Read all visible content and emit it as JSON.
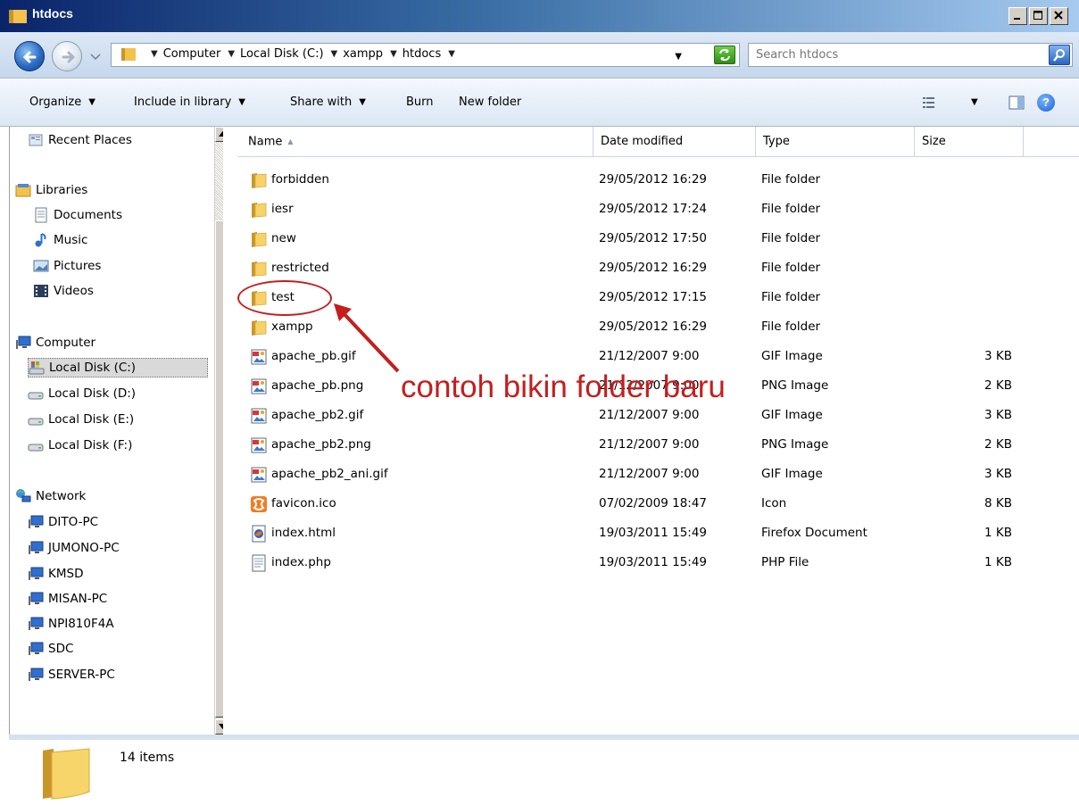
{
  "window": {
    "title": "htdocs"
  },
  "address": {
    "crumbs": [
      "Computer",
      "Local Disk (C:)",
      "xampp",
      "htdocs"
    ]
  },
  "search": {
    "placeholder": "Search htdocs"
  },
  "toolbar": {
    "organize": "Organize",
    "include_in_library": "Include in library",
    "share_with": "Share with",
    "burn": "Burn",
    "new_folder": "New folder"
  },
  "nav": {
    "recent_places": "Recent Places",
    "libraries": "Libraries",
    "documents": "Documents",
    "music": "Music",
    "pictures": "Pictures",
    "videos": "Videos",
    "computer": "Computer",
    "disk_c": "Local Disk (C:)",
    "disk_d": "Local Disk (D:)",
    "disk_e": "Local Disk (E:)",
    "disk_f": "Local Disk (F:)",
    "network": "Network",
    "pc1": "DITO-PC",
    "pc2": "JUMONO-PC",
    "pc3": "KMSD",
    "pc4": "MISAN-PC",
    "pc5": "NPI810F4A",
    "pc6": "SDC",
    "pc7": "SERVER-PC"
  },
  "columns": {
    "name": "Name",
    "date": "Date modified",
    "type": "Type",
    "size": "Size"
  },
  "files": [
    {
      "name": "forbidden",
      "date": "29/05/2012 16:29",
      "type": "File folder",
      "size": "",
      "icon": "folder-icon"
    },
    {
      "name": "iesr",
      "date": "29/05/2012 17:24",
      "type": "File folder",
      "size": "",
      "icon": "folder-icon"
    },
    {
      "name": "new",
      "date": "29/05/2012 17:50",
      "type": "File folder",
      "size": "",
      "icon": "folder-icon"
    },
    {
      "name": "restricted",
      "date": "29/05/2012 16:29",
      "type": "File folder",
      "size": "",
      "icon": "folder-icon"
    },
    {
      "name": "test",
      "date": "29/05/2012 17:15",
      "type": "File folder",
      "size": "",
      "icon": "folder-icon"
    },
    {
      "name": "xampp",
      "date": "29/05/2012 16:29",
      "type": "File folder",
      "size": "",
      "icon": "folder-icon"
    },
    {
      "name": "apache_pb.gif",
      "date": "21/12/2007 9:00",
      "type": "GIF Image",
      "size": "3 KB",
      "icon": "image-file-icon"
    },
    {
      "name": "apache_pb.png",
      "date": "21/12/2007 9:00",
      "type": "PNG Image",
      "size": "2 KB",
      "icon": "image-file-icon"
    },
    {
      "name": "apache_pb2.gif",
      "date": "21/12/2007 9:00",
      "type": "GIF Image",
      "size": "3 KB",
      "icon": "image-file-icon"
    },
    {
      "name": "apache_pb2.png",
      "date": "21/12/2007 9:00",
      "type": "PNG Image",
      "size": "2 KB",
      "icon": "image-file-icon"
    },
    {
      "name": "apache_pb2_ani.gif",
      "date": "21/12/2007 9:00",
      "type": "GIF Image",
      "size": "3 KB",
      "icon": "image-file-icon"
    },
    {
      "name": "favicon.ico",
      "date": "07/02/2009 18:47",
      "type": "Icon",
      "size": "8 KB",
      "icon": "xampp-icon"
    },
    {
      "name": "index.html",
      "date": "19/03/2011 15:49",
      "type": "Firefox Document",
      "size": "1 KB",
      "icon": "firefox-document-icon"
    },
    {
      "name": "index.php",
      "date": "19/03/2011 15:49",
      "type": "PHP File",
      "size": "1 KB",
      "icon": "text-file-icon"
    }
  ],
  "annotation": {
    "text": "contoh bikin folder baru",
    "color": "#c41e1e"
  },
  "details": {
    "count": "14 items"
  },
  "colors": {
    "title_bar": "#0a246a",
    "folder": "#f2c24b",
    "selection": "#d9d9d9"
  }
}
